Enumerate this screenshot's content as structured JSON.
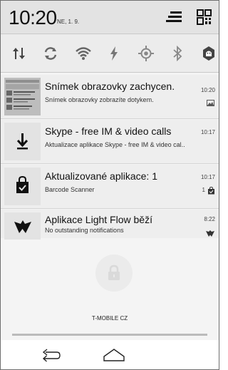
{
  "status_bar": {
    "time": "10:20",
    "date": "NE, 1. 9.",
    "icons": [
      "menu-icon",
      "qr-grid-icon"
    ]
  },
  "quick_settings": {
    "icons": [
      "data-sync-arrows-icon",
      "sync-icon",
      "wifi-icon",
      "flash-icon",
      "gps-icon",
      "bluetooth-icon",
      "android-icon"
    ]
  },
  "notifications": [
    {
      "icon": "screenshot-thumbnail",
      "title": "Snímek obrazovky zachycen.",
      "subtitle": "Snímek obrazovky zobrazíte dotykem.",
      "time": "10:20",
      "extra_icon": "image-icon"
    },
    {
      "icon": "download-icon",
      "title": "Skype - free IM & video calls",
      "subtitle": "Aktualizace aplikace Skype - free IM & video cal..",
      "time": "10:17"
    },
    {
      "icon": "store-bag-icon",
      "title": "Aktualizované aplikace: 1",
      "subtitle": "Barcode Scanner",
      "time": "10:17",
      "count": "1",
      "extra_icon": "store-bag-icon"
    },
    {
      "icon": "light-flow-icon",
      "title": "Aplikace Light Flow běží",
      "subtitle": "No outstanding notifications",
      "time": "8:22",
      "extra_icon": "light-flow-icon"
    }
  ],
  "lock_icon": "lock-icon",
  "carrier": "T-MOBILE CZ",
  "nav": {
    "back_icon": "back-icon",
    "home_icon": "home-icon"
  }
}
